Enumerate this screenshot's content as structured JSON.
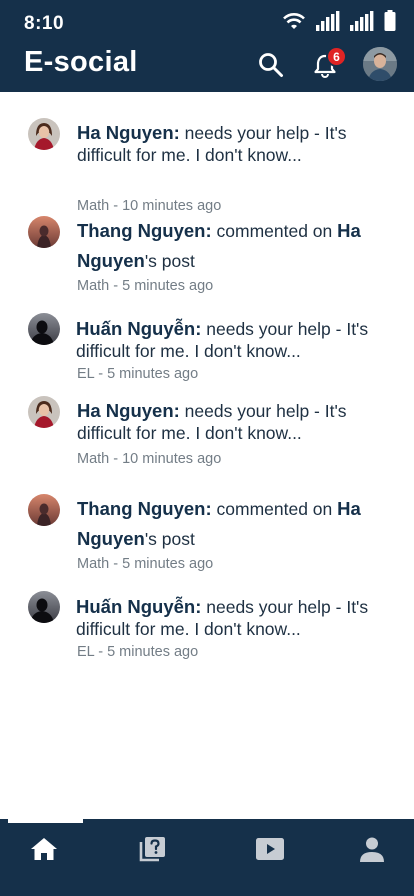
{
  "status_bar": {
    "time": "8:10"
  },
  "header": {
    "title": "E-social",
    "notification_count": "6"
  },
  "notifications": [
    {
      "name": "Ha Nguyen:",
      "message": " needs your help - It's difficult for me. I don't know...",
      "meta": "Math - 10 minutes ago",
      "avatar": "woman-red"
    },
    {
      "name": "Thang Nguyen:",
      "message": " commented on ",
      "target": "Ha Nguyen",
      "suffix": "'s post",
      "meta": "Math - 5 minutes ago",
      "avatar": "sunset"
    },
    {
      "name": "Huấn Nguyễn:",
      "message": " needs your help - It's difficult for me. I don't know...",
      "meta": "EL - 5 minutes ago",
      "avatar": "silhouette"
    },
    {
      "name": "Ha Nguyen:",
      "message": " needs your help - It's difficult for me. I don't know...",
      "meta": "Math - 10 minutes ago",
      "avatar": "woman-red"
    },
    {
      "name": "Thang Nguyen:",
      "message": " commented on ",
      "target": "Ha Nguyen",
      "suffix": "'s post",
      "meta": "Math - 5 minutes ago",
      "avatar": "sunset"
    },
    {
      "name": "Huấn Nguyễn:",
      "message": " needs your help - It's difficult for me. I don't know...",
      "meta": "EL - 5 minutes ago",
      "avatar": "silhouette"
    }
  ],
  "bottom_nav": [
    {
      "icon": "home-icon",
      "active": true
    },
    {
      "icon": "question-library-icon",
      "active": false
    },
    {
      "icon": "video-play-icon",
      "active": false
    },
    {
      "icon": "profile-icon",
      "active": false
    }
  ],
  "colors": {
    "primary": "#15304a",
    "badge": "#e02424",
    "text": "#1e3042",
    "meta": "#737d86"
  }
}
